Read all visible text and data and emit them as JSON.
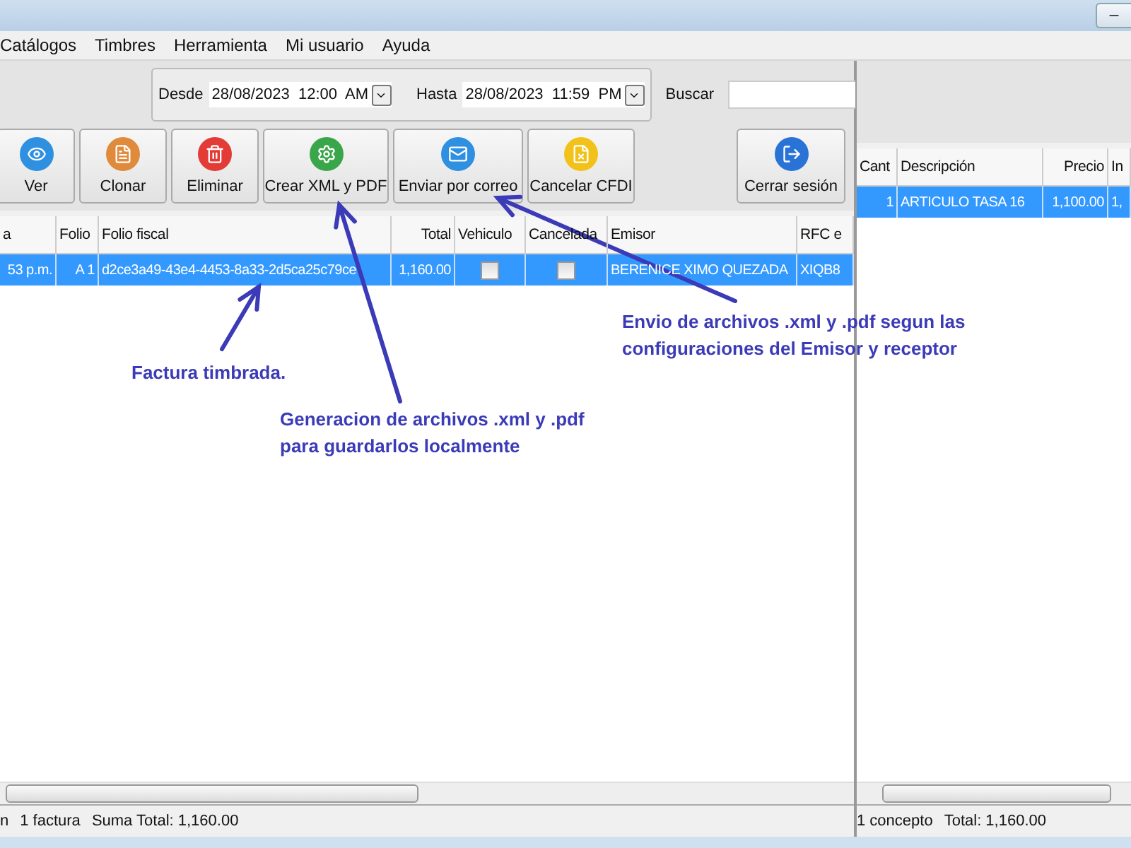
{
  "menu": [
    "Catálogos",
    "Timbres",
    "Herramienta",
    "Mi usuario",
    "Ayuda"
  ],
  "date_filter": {
    "from_label": "Desde",
    "from_value": "28/08/2023  12:00  AM",
    "to_label": "Hasta",
    "to_value": "28/08/2023  11:59  PM"
  },
  "search": {
    "label": "Buscar"
  },
  "toolbar": [
    {
      "label": "Ver",
      "kind": "view"
    },
    {
      "label": "Clonar",
      "kind": "clone"
    },
    {
      "label": "Eliminar",
      "kind": "delete"
    },
    {
      "label": "Crear XML y PDF",
      "kind": "xml"
    },
    {
      "label": "Enviar por correo",
      "kind": "mail"
    },
    {
      "label": "Cancelar CFDI",
      "kind": "cancel"
    },
    {
      "label": "Cerrar sesión",
      "kind": "logout"
    }
  ],
  "invoices": {
    "columns": [
      "a",
      "Folio",
      "Folio fiscal",
      "Total",
      "Vehiculo",
      "Cancelada",
      "Emisor",
      "RFC e"
    ],
    "rows": [
      {
        "selected": true,
        "cells": [
          {
            "kind": "text",
            "value": "53 p.m."
          },
          {
            "kind": "text",
            "value": "A 1"
          },
          {
            "kind": "text",
            "value": "d2ce3a49-43e4-4453-8a33-2d5ca25c79ce"
          },
          {
            "kind": "text",
            "value": "1,160.00"
          },
          {
            "kind": "check",
            "checked": false
          },
          {
            "kind": "check",
            "checked": false
          },
          {
            "kind": "text",
            "value": "BERENICE XIMO QUEZADA"
          },
          {
            "kind": "text",
            "value": "XIQB8"
          }
        ]
      }
    ]
  },
  "status_left": [
    "n",
    "1 factura",
    "Suma Total: 1,160.00"
  ],
  "concepts": {
    "columns": [
      "Cant",
      "Descripción",
      "Precio",
      "In"
    ],
    "rows": [
      {
        "selected": true,
        "cells": [
          "1",
          "ARTICULO TASA 16",
          "1,100.00",
          "1,"
        ]
      }
    ]
  },
  "status_right": [
    "1 concepto",
    "Total: 1,160.00"
  ],
  "annotations": [
    {
      "text": "Factura timbrada."
    },
    {
      "text": "Generacion de archivos .xml y .pdf\npara guardarlos localmente"
    },
    {
      "text": "Envio de archivos .xml y .pdf segun las\nconfiguraciones del Emisor y receptor"
    }
  ]
}
